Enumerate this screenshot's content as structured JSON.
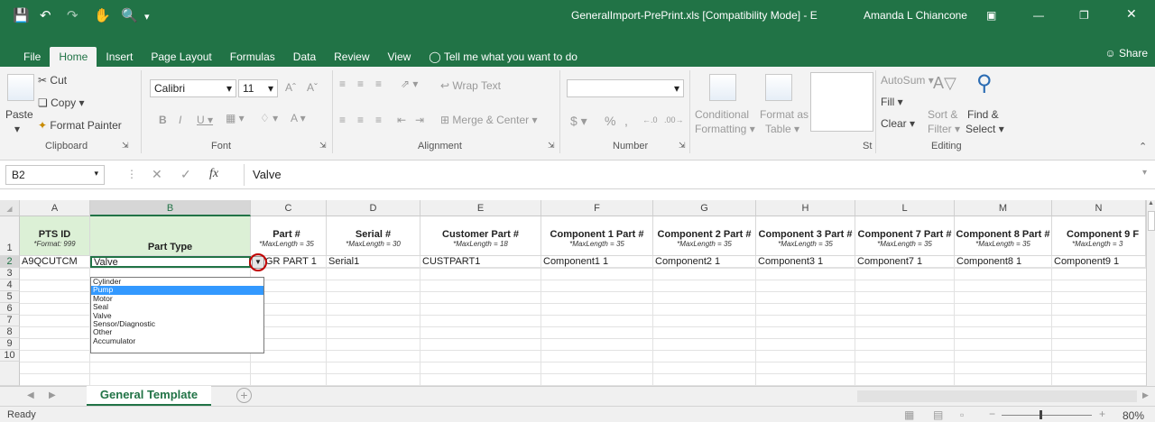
{
  "titlebar": {
    "title": "GeneralImport-PrePrint.xls  [Compatibility Mode] - E",
    "user": "Amanda L Chiancone"
  },
  "tabs": [
    "File",
    "Home",
    "Insert",
    "Page Layout",
    "Formulas",
    "Data",
    "Review",
    "View"
  ],
  "tell_me": "Tell me what you want to do",
  "share": "Share",
  "ribbon": {
    "clipboard": {
      "paste": "Paste",
      "cut": "Cut",
      "copy": "Copy",
      "format_painter": "Format Painter",
      "label": "Clipboard"
    },
    "font": {
      "name": "Calibri",
      "size": "11",
      "label": "Font"
    },
    "alignment": {
      "wrap": "Wrap Text",
      "merge": "Merge & Center",
      "label": "Alignment"
    },
    "number": {
      "label": "Number",
      "dollar": "$",
      "percent": "%",
      "comma": ","
    },
    "styles": {
      "conditional": "Conditional",
      "formatting": "Formatting",
      "format_as": "Format as",
      "table": "Table",
      "label": "St"
    },
    "editing": {
      "autosum": "AutoSum",
      "fill": "Fill",
      "clear": "Clear",
      "sort": "Sort &",
      "filter": "Filter",
      "find": "Find &",
      "select": "Select",
      "label": "Editing"
    }
  },
  "formula": {
    "namebox": "B2",
    "value": "Valve",
    "fx": "fx"
  },
  "columns": [
    "A",
    "B",
    "C",
    "D",
    "E",
    "F",
    "G",
    "H",
    "L",
    "M",
    "N"
  ],
  "headers": [
    {
      "title": "PTS ID",
      "sub": "*Format: 999"
    },
    {
      "title": "Part Type",
      "sub": ""
    },
    {
      "title": "Part #",
      "sub": "*MaxLength = 35"
    },
    {
      "title": "Serial #",
      "sub": "*MaxLength = 30"
    },
    {
      "title": "Customer Part #",
      "sub": "*MaxLength = 18"
    },
    {
      "title": "Component 1 Part #",
      "sub": "*MaxLength = 35"
    },
    {
      "title": "Component 2 Part #",
      "sub": "*MaxLength = 35"
    },
    {
      "title": "Component 3 Part #",
      "sub": "*MaxLength = 35"
    },
    {
      "title": "Component 7 Part #",
      "sub": "*MaxLength = 35"
    },
    {
      "title": "Component 8 Part #",
      "sub": "*MaxLength = 35"
    },
    {
      "title": "Component 9 F",
      "sub": "*MaxLength = 3"
    }
  ],
  "row2": [
    "A9QCUTCM",
    "Valve",
    "GR PART 1",
    "Serial1",
    "CUSTPART1",
    "Component1 1",
    "Component2 1",
    "Component3 1",
    "Component7 1",
    "Component8 1",
    "Component9 1"
  ],
  "rows": [
    "1",
    "2",
    "3",
    "4",
    "5",
    "6",
    "7",
    "8",
    "9",
    "10"
  ],
  "dropdown": [
    "Cylinder",
    "Pump",
    "Motor",
    "Seal",
    "Valve",
    "Sensor/Diagnostic",
    "Other",
    "Accumulator"
  ],
  "dropdown_selected": "Pump",
  "sheet": {
    "tab": "General Template",
    "add": "+"
  },
  "status": {
    "state": "Ready",
    "zoom": "80%"
  }
}
